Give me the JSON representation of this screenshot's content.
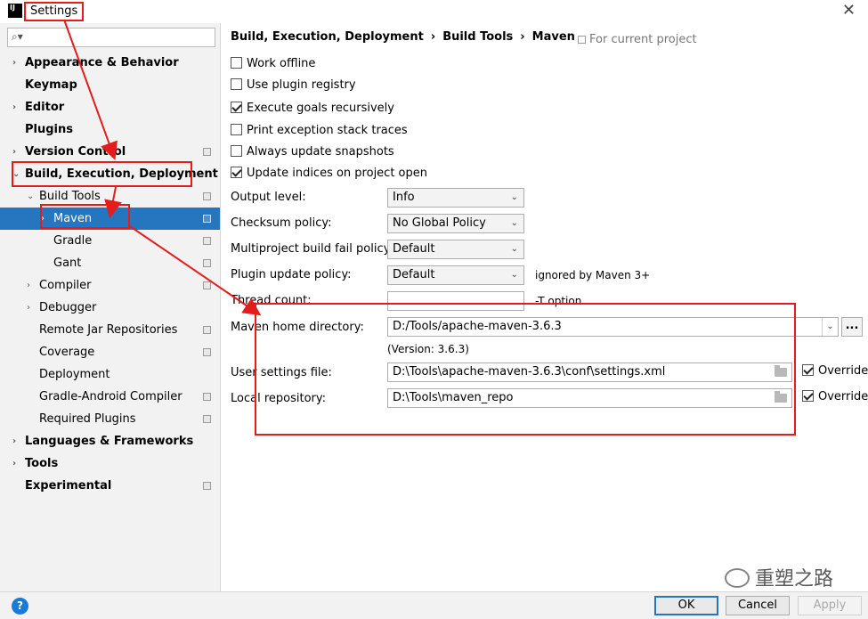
{
  "window": {
    "title": "Settings",
    "logo_text": "IJ",
    "close_glyph": "✕"
  },
  "search": {
    "placeholder": ""
  },
  "sidebar": {
    "items": [
      {
        "label": "Appearance & Behavior",
        "arrow": "›"
      },
      {
        "label": "Keymap"
      },
      {
        "label": "Editor",
        "arrow": "›"
      },
      {
        "label": "Plugins"
      },
      {
        "label": "Version Control",
        "arrow": "›"
      },
      {
        "label": "Build, Execution, Deployment",
        "arrow": "⌄"
      },
      {
        "label": "Build Tools",
        "arrow": "⌄"
      },
      {
        "label": "Maven",
        "arrow": "›"
      },
      {
        "label": "Gradle"
      },
      {
        "label": "Gant"
      },
      {
        "label": "Compiler",
        "arrow": "›"
      },
      {
        "label": "Debugger",
        "arrow": "›"
      },
      {
        "label": "Remote Jar Repositories"
      },
      {
        "label": "Coverage"
      },
      {
        "label": "Deployment"
      },
      {
        "label": "Gradle-Android Compiler"
      },
      {
        "label": "Required Plugins"
      },
      {
        "label": "Languages & Frameworks",
        "arrow": "›"
      },
      {
        "label": "Tools",
        "arrow": "›"
      },
      {
        "label": "Experimental"
      }
    ]
  },
  "breadcrumb": {
    "part1": "Build, Execution, Deployment",
    "part2": "Build Tools",
    "part3": "Maven",
    "sep": "›",
    "scope": "For current project"
  },
  "checkboxes": [
    {
      "label": "Work offline",
      "checked": false
    },
    {
      "label": "Use plugin registry",
      "checked": false
    },
    {
      "label": "Execute goals recursively",
      "checked": true
    },
    {
      "label": "Print exception stack traces",
      "checked": false
    },
    {
      "label": "Always update snapshots",
      "checked": false
    },
    {
      "label": "Update indices on project open",
      "checked": true
    }
  ],
  "form": {
    "output_level": {
      "label": "Output level:",
      "value": "Info"
    },
    "checksum_policy": {
      "label": "Checksum policy:",
      "value": "No Global Policy"
    },
    "multiproject": {
      "label": "Multiproject build fail policy:",
      "value": "Default"
    },
    "plugin_update": {
      "label": "Plugin update policy:",
      "value": "Default",
      "note": "ignored by Maven 3+"
    },
    "thread_count": {
      "label": "Thread count:",
      "value": "",
      "note": "-T option"
    },
    "maven_home": {
      "label": "Maven home directory:",
      "value": "D:/Tools/apache-maven-3.6.3",
      "version": "(Version: 3.6.3)",
      "browse": "..."
    },
    "user_settings": {
      "label": "User settings file:",
      "value": "D:\\Tools\\apache-maven-3.6.3\\conf\\settings.xml",
      "override": "Override",
      "override_checked": true
    },
    "local_repo": {
      "label": "Local repository:",
      "value": "D:\\Tools\\maven_repo",
      "override": "Override",
      "override_checked": true
    }
  },
  "footer": {
    "help": "?",
    "ok": "OK",
    "cancel": "Cancel",
    "apply": "Apply"
  },
  "watermark": {
    "text": "重塑之路"
  },
  "colors": {
    "selection": "#2675bf",
    "annotation": "#e41c1c",
    "help": "#1a7ad8"
  }
}
